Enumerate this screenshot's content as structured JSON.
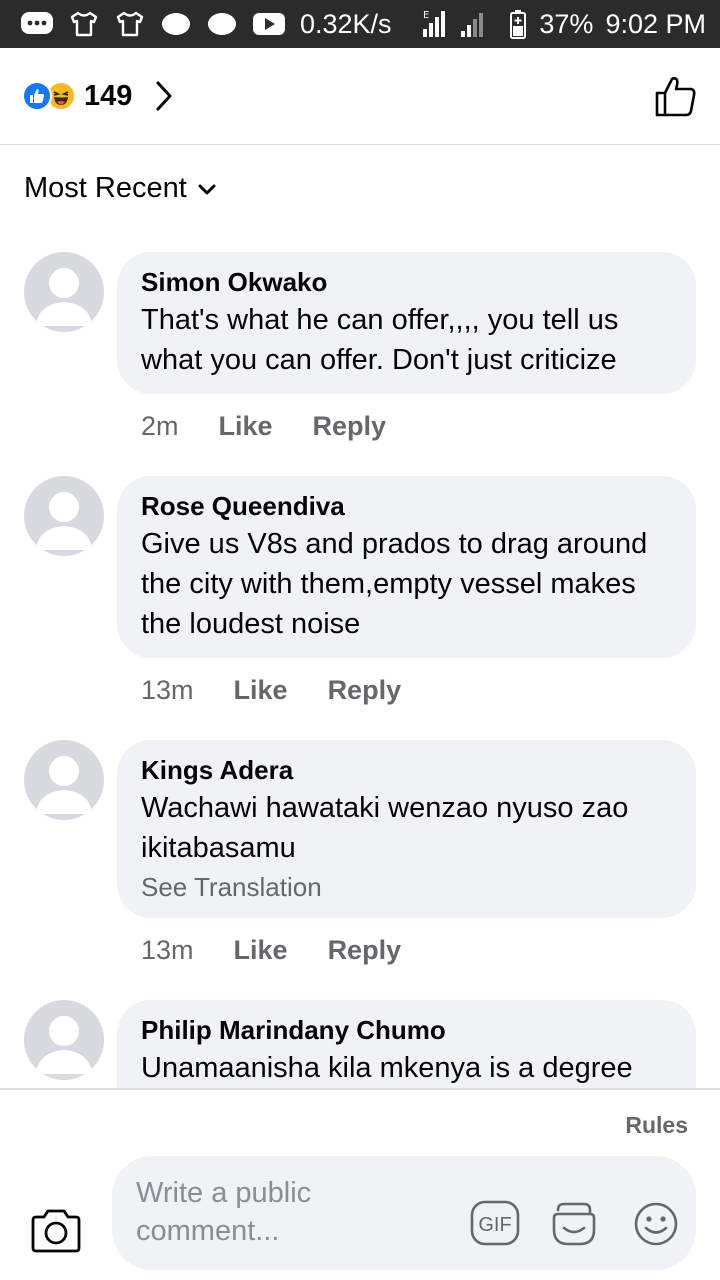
{
  "status_bar": {
    "speed": "0.32K/s",
    "network": "E",
    "battery": "37%",
    "time": "9:02 PM"
  },
  "header": {
    "reaction_count": "149",
    "reactions": [
      "like-icon",
      "haha-icon"
    ]
  },
  "sort": {
    "label": "Most Recent"
  },
  "comments": [
    {
      "name": "Simon Okwako",
      "text": "That's what he can offer,,,, you tell us what you can offer. Don't just criticize",
      "time": "2m",
      "like": "Like",
      "reply": "Reply"
    },
    {
      "name": "Rose Queendiva",
      "text": "Give us V8s and prados to drag around the city with them,empty vessel makes the loudest noise",
      "time": "13m",
      "like": "Like",
      "reply": "Reply"
    },
    {
      "name": "Kings Adera",
      "text": "Wachawi hawataki wenzao nyuso zao ikitabasamu",
      "see_translation": "See Translation",
      "time": "13m",
      "like": "Like",
      "reply": "Reply"
    },
    {
      "name": "Philip Marindany Chumo",
      "text": "Unamaanisha kila mkenya is a degree holder? Kama ni hivyo, haujui"
    }
  ],
  "footer": {
    "rules": "Rules",
    "placeholder": "Write a public comment...",
    "gif": "GIF"
  },
  "colors": {
    "like_blue": "#1877f2",
    "haha_yellow": "#f7b928",
    "bubble": "#f0f2f5",
    "secondary_text": "#65676b",
    "status_bar": "#2b2b2b"
  }
}
